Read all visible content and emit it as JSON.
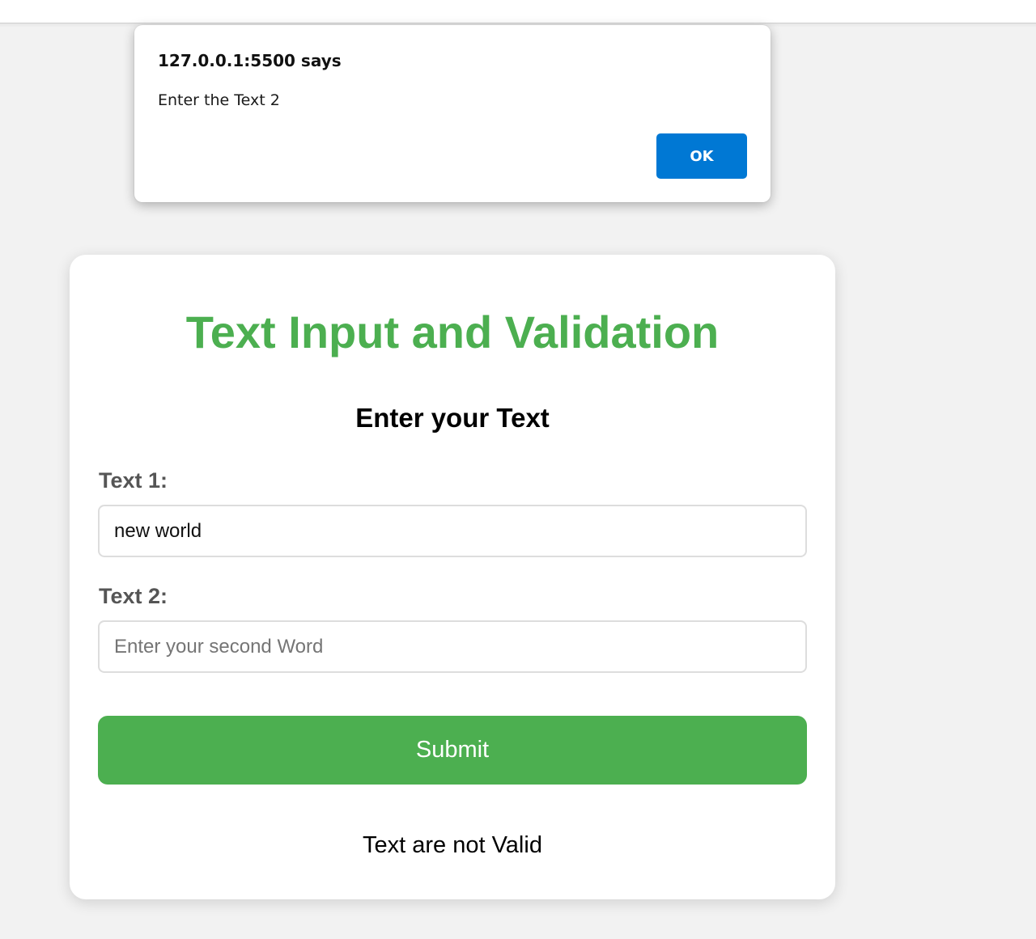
{
  "alert": {
    "title": "127.0.0.1:5500 says",
    "message": "Enter the Text 2",
    "ok_label": "OK",
    "ok_color": "#0078d4"
  },
  "card": {
    "title": "Text Input and Validation",
    "title_color": "#4caf50",
    "subtitle": "Enter your Text",
    "fields": [
      {
        "label": "Text 1:",
        "value": "new world",
        "placeholder": ""
      },
      {
        "label": "Text 2:",
        "value": "",
        "placeholder": "Enter your second Word"
      }
    ],
    "submit_label": "Submit",
    "submit_color": "#4caf50",
    "result": "Text are not Valid"
  }
}
